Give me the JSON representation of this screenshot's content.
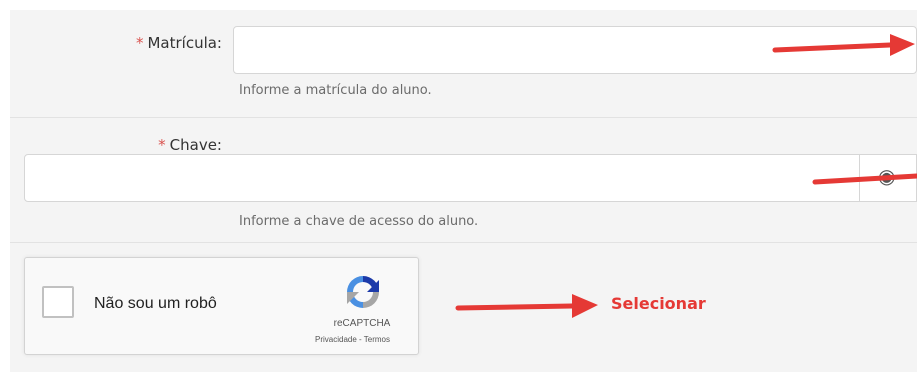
{
  "form": {
    "matricula": {
      "required_mark": "*",
      "label": "Matrícula:",
      "value": "",
      "help": "Informe a matrícula do aluno."
    },
    "chave": {
      "required_mark": "*",
      "label": "Chave:",
      "value": "",
      "help": "Informe a chave de acesso do aluno.",
      "toggle_icon": "eye-icon"
    }
  },
  "recaptcha": {
    "checkbox_label": "Não sou um robô",
    "checked": false,
    "brand": "reCAPTCHA",
    "links": "Privacidade - Termos"
  },
  "annotation": {
    "callout_text": "Selecionar",
    "arrow_color": "#e53935"
  },
  "colors": {
    "required": "#d9534f",
    "panel_bg": "#f4f4f4",
    "annotation": "#e53935"
  }
}
